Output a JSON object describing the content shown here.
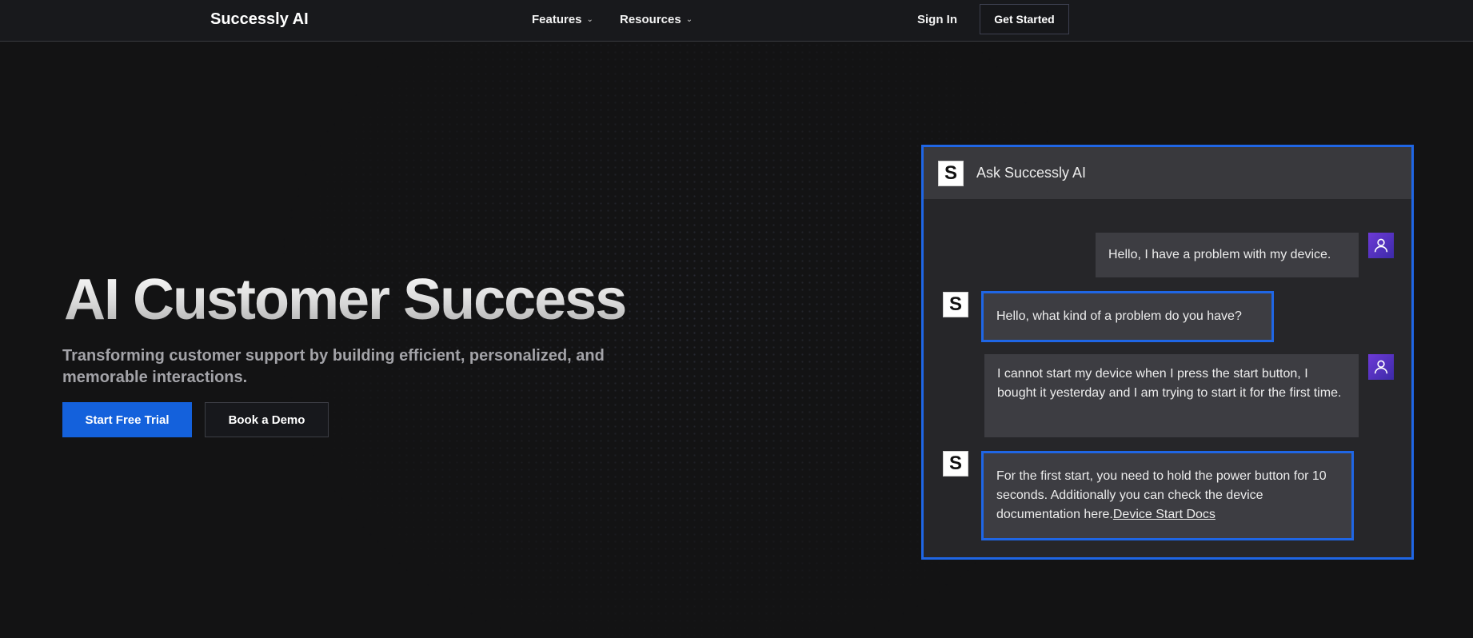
{
  "nav": {
    "brand": "Successly AI",
    "features": "Features",
    "resources": "Resources",
    "sign_in": "Sign In",
    "get_started": "Get Started"
  },
  "hero": {
    "title": "AI Customer Success",
    "subtitle": "Transforming customer support by building efficient, personalized, and memorable interactions.",
    "primary_cta": "Start Free Trial",
    "secondary_cta": "Book a Demo"
  },
  "chat": {
    "logo_letter": "S",
    "title": "Ask Successly AI",
    "messages": [
      {
        "role": "user",
        "text": "Hello, I have a problem with my device."
      },
      {
        "role": "bot",
        "text": "Hello, what kind of a problem do you have?"
      },
      {
        "role": "user",
        "text": "I cannot start my device when I press the start button, I bought it yesterday and I am trying to start it for the first time."
      },
      {
        "role": "bot",
        "text": "For the first start, you need to hold the power button for 10 seconds. Additionally you can check the device documentation here.",
        "link": "Device Start Docs"
      }
    ]
  },
  "colors": {
    "background": "#131314",
    "accent": "#1461dc",
    "chat_border": "#1f66e5",
    "avatar": "#5a33c8"
  }
}
